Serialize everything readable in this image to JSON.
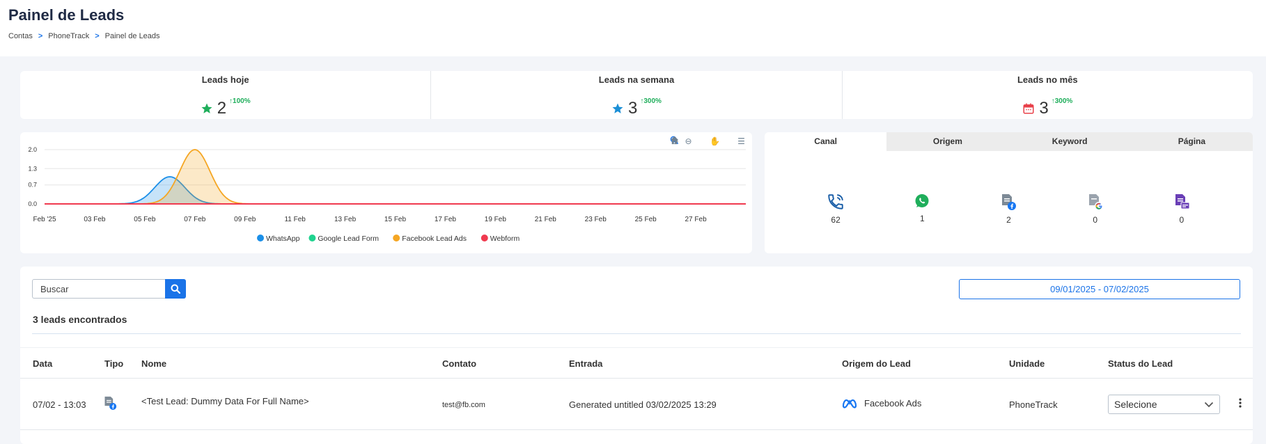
{
  "header": {
    "title": "Painel de Leads",
    "breadcrumb": [
      "Contas",
      "PhoneTrack",
      "Painel de Leads"
    ],
    "breadcrumb_sep": ">"
  },
  "kpis": [
    {
      "label": "Leads hoje",
      "value": "2",
      "trend": "↑100%",
      "icon": "star-icon",
      "color": "#1fae5b"
    },
    {
      "label": "Leads na semana",
      "value": "3",
      "trend": "↑300%",
      "icon": "star-icon",
      "color": "#1b8fd6"
    },
    {
      "label": "Leads no mês",
      "value": "3",
      "trend": "↑300%",
      "icon": "calendar-icon",
      "color": "#e8414a"
    }
  ],
  "chart_data": {
    "type": "area",
    "x": [
      "Feb '25",
      "03 Feb",
      "05 Feb",
      "07 Feb",
      "09 Feb",
      "11 Feb",
      "13 Feb",
      "15 Feb",
      "17 Feb",
      "19 Feb",
      "21 Feb",
      "23 Feb",
      "25 Feb",
      "27 Feb"
    ],
    "x_index": [
      1,
      3,
      5,
      7,
      9,
      11,
      13,
      15,
      17,
      19,
      21,
      23,
      25,
      27
    ],
    "ylim": [
      0,
      2.0
    ],
    "yticks": [
      "0.0",
      "0.7",
      "1.3",
      "2.0"
    ],
    "grid": true,
    "legend": "bottom",
    "series": [
      {
        "name": "WhatsApp",
        "color": "#1b8fe8",
        "peak_day": 6,
        "peak": 1
      },
      {
        "name": "Google Lead Form",
        "color": "#1fd38f",
        "peak_day": null,
        "peak": 0
      },
      {
        "name": "Facebook Lead Ads",
        "color": "#f5a623",
        "peak_day": 7,
        "peak": 2
      },
      {
        "name": "Webform",
        "color": "#f03a4f",
        "peak_day": null,
        "peak": 0
      }
    ]
  },
  "tabs": [
    {
      "label": "Canal",
      "active": true
    },
    {
      "label": "Origem",
      "active": false
    },
    {
      "label": "Keyword",
      "active": false
    },
    {
      "label": "Página",
      "active": false
    }
  ],
  "channels": [
    {
      "icon": "phone-call-icon",
      "count": "62",
      "color": "#1b5fa8"
    },
    {
      "icon": "whatsapp-icon",
      "count": "1",
      "color": "#1fae5b"
    },
    {
      "icon": "facebook-form-icon",
      "count": "2",
      "color": "#1877f2"
    },
    {
      "icon": "google-form-icon",
      "count": "0",
      "color": "#4285f4"
    },
    {
      "icon": "webform-icon",
      "count": "0",
      "color": "#6a3fb6"
    }
  ],
  "search": {
    "placeholder": "Buscar"
  },
  "date_range": "09/01/2025 - 07/02/2025",
  "found": "3 leads encontrados",
  "table": {
    "columns": [
      "Data",
      "Tipo",
      "Nome",
      "Contato",
      "Entrada",
      "Origem do Lead",
      "Unidade",
      "Status do Lead"
    ],
    "rows": [
      {
        "data": "07/02 - 13:03",
        "tipo_icon": "facebook-form-icon",
        "nome": "<Test Lead: Dummy Data For Full Name>",
        "contato": "test@fb.com",
        "entrada": "Generated untitled 03/02/2025 13:29",
        "origem": "Facebook Ads",
        "unidade": "PhoneTrack",
        "status": "Selecione"
      }
    ]
  },
  "colors": {
    "accent": "#1a73e8",
    "positive": "#1fae5b"
  }
}
